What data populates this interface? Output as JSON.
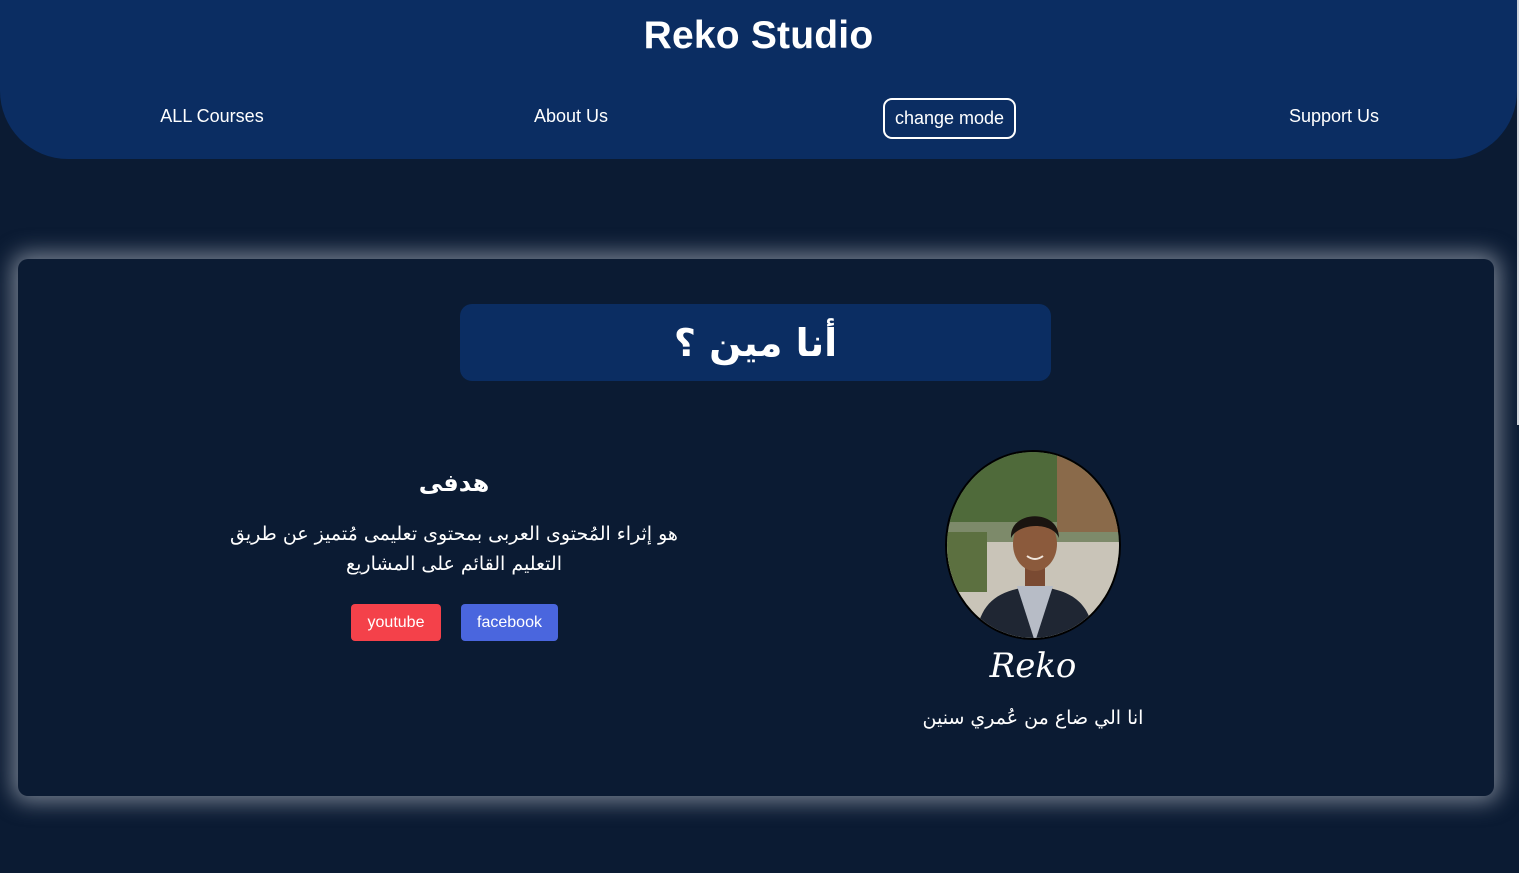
{
  "header": {
    "brand": "Reko Studio",
    "nav": {
      "all_courses": "ALL Courses",
      "about_us": "About Us",
      "change_mode": "change mode",
      "support_us": "Support Us"
    }
  },
  "about": {
    "title": "أنا مين ؟",
    "goal_heading": "هدفى",
    "goal_line1": "هو إثراء المُحتوى العربى بمحتوى تعليمى مُتميز عن طريق",
    "goal_line2": "التعليم القائم على المشاريع",
    "youtube_label": "youtube",
    "facebook_label": "facebook",
    "name": "Reko",
    "bio": "انا الي ضاع من عُمري سنين"
  },
  "colors": {
    "background": "#0b1b33",
    "header": "#0b2d62",
    "youtube": "#f4414a",
    "facebook": "#4a66de"
  }
}
